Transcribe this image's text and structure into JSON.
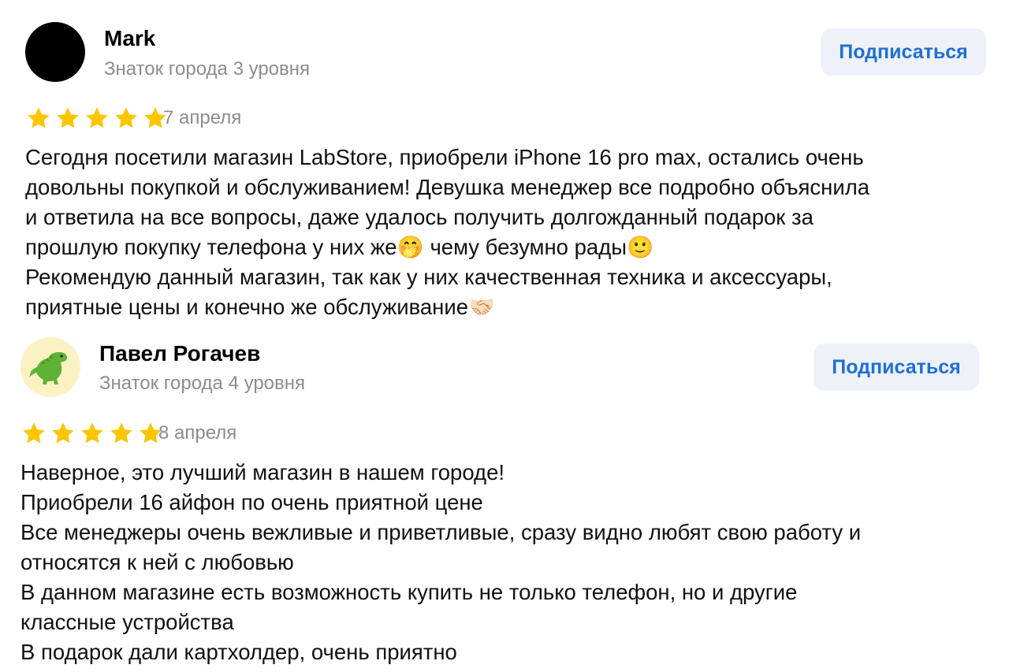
{
  "reviews": [
    {
      "author": "Mark",
      "level": "Знаток города 3 уровня",
      "subscribe_label": "Подписаться",
      "rating": 5,
      "date": "7 апреля",
      "text_lines": [
        "Сегодня посетили магазин LabStore, приобрели iPhone 16 pro max, остались очень",
        "довольны покупкой и обслуживанием! Девушка менеджер все подробно объяснила",
        "и ответила на все вопросы, даже удалось получить долгожданный подарок за",
        "прошлую покупку телефона у них же🤭 чему безумно рады🙂",
        "Рекомендую данный магазин, так как у них качественная техника и аксессуары,",
        "приятные цены и конечно же обслуживание🤝🏻"
      ]
    },
    {
      "author": "Павел Рогачев",
      "level": "Знаток города 4 уровня",
      "subscribe_label": "Подписаться",
      "rating": 5,
      "date": "8 апреля",
      "text_lines": [
        "Наверное, это лучший магазин в нашем городе!",
        "Приобрели 16 айфон по очень приятной цене",
        "Все менеджеры очень вежливые и приветливые, сразу видно любят свою работу и",
        "относятся к ней с любовью",
        "В данном магазине есть возможность купить не только телефон, но и другие",
        "классные устройства",
        "В подарок дали картхолдер, очень приятно"
      ]
    }
  ],
  "colors": {
    "star": "#fdc500",
    "link": "#1f6fd6",
    "secondary_text": "#8c8c8c",
    "button_bg": "#eef2f8"
  },
  "icons": {
    "star": "star-icon",
    "avatar_2": "dinosaur-icon"
  }
}
